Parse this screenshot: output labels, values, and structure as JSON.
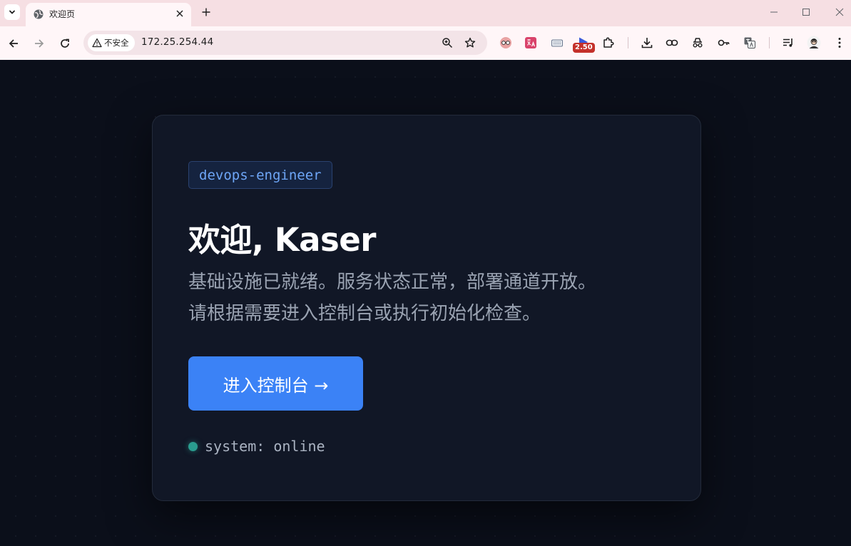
{
  "browser": {
    "tab": {
      "title": "欢迎页",
      "favicon": "globe-icon"
    },
    "address": {
      "security_label": "不安全",
      "url": "172.25.254.44"
    },
    "extension_badge": "2.50",
    "colors": {
      "tabbar": "#f6dfe3",
      "toolbar": "#fff6f8",
      "omnibox": "#f3e4e8"
    }
  },
  "page": {
    "role_tag": "devops-engineer",
    "heading": "欢迎, Kaser",
    "subtitle_line1": "基础设施已就绪。服务状态正常，部署通道开放。",
    "subtitle_line2": "请根据需要进入控制台或执行初始化检查。",
    "cta_label": "进入控制台 →",
    "status_text": "system: online",
    "colors": {
      "background": "#0b0f1a",
      "card": "#111726",
      "accent": "#3b82f6",
      "status": "#2a9d8f"
    }
  }
}
